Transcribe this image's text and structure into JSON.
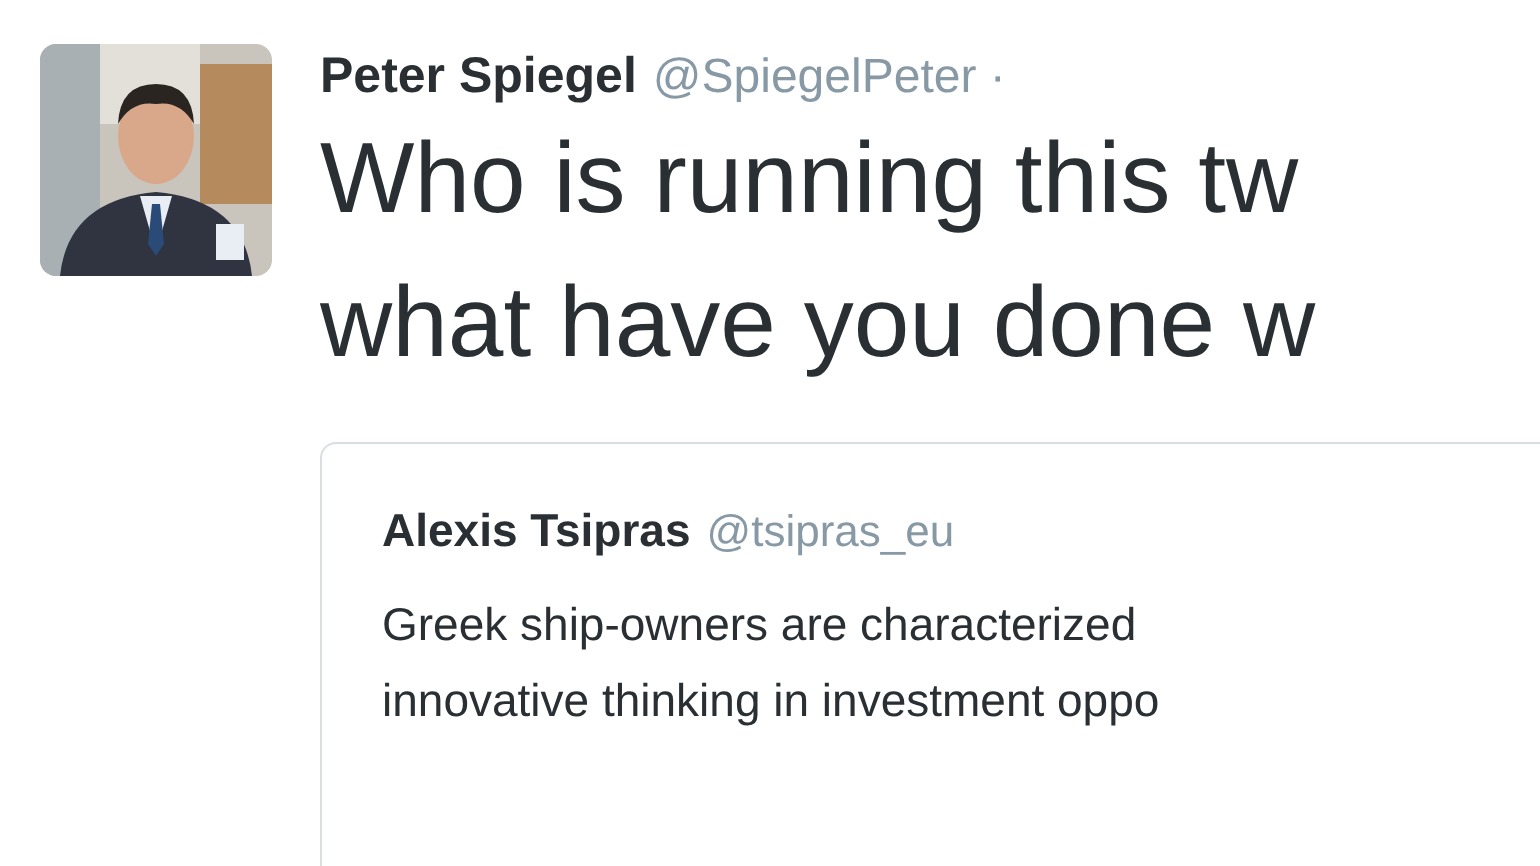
{
  "tweet": {
    "author_name": "Peter Spiegel",
    "author_handle": "@SpiegelPeter ·",
    "text_lines": [
      "Who is running this tw",
      "what have you done w"
    ],
    "quoted": {
      "author_name": "Alexis Tsipras",
      "author_handle": "@tsipras_eu",
      "text_lines": [
        "Greek ship-owners are characterized",
        "innovative thinking in investment oppo"
      ]
    }
  }
}
